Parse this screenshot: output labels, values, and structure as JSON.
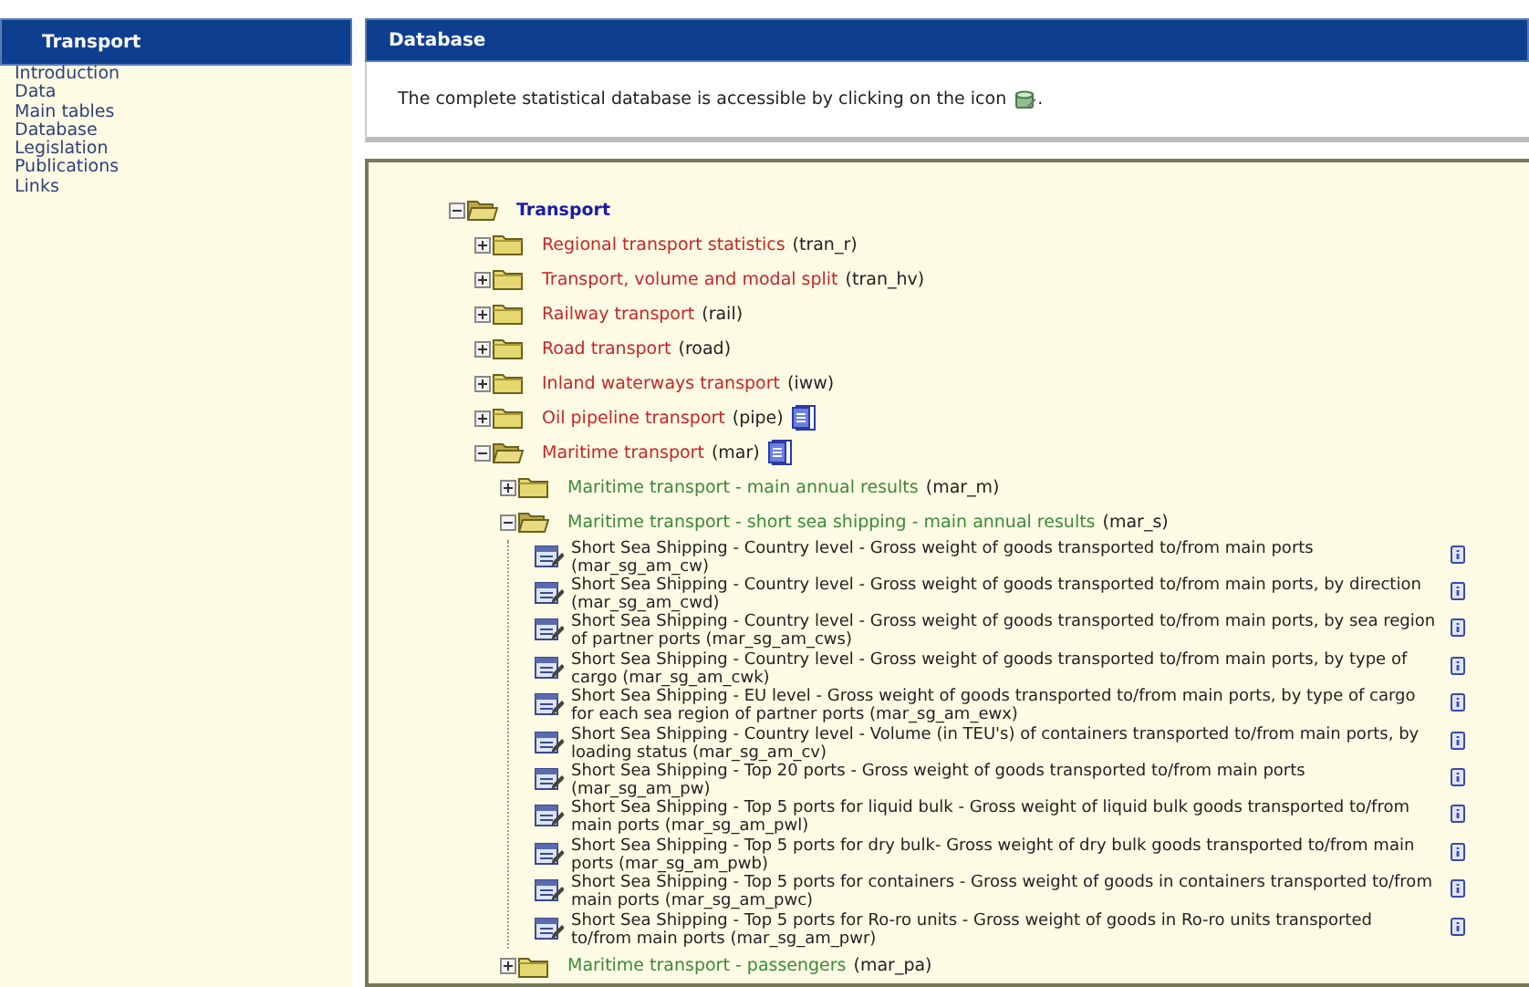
{
  "sidebar": {
    "title": "Transport",
    "items": [
      {
        "label": "Introduction"
      },
      {
        "label": "Data"
      },
      {
        "label": "Main tables"
      },
      {
        "label": "Database"
      },
      {
        "label": "Legislation"
      },
      {
        "label": "Publications"
      },
      {
        "label": "Links"
      }
    ]
  },
  "main": {
    "title": "Database",
    "intro": "The complete statistical database is accessible by clicking on the icon",
    "intro_end": "."
  },
  "tree": {
    "kind": "folder",
    "name": "Transport",
    "expanded": true,
    "doc": false,
    "children": [
      {
        "kind": "folder",
        "name": "Regional transport statistics",
        "code": "(tran_r)",
        "expanded": false,
        "doc": false
      },
      {
        "kind": "folder",
        "name": "Transport, volume and modal split",
        "code": "(tran_hv)",
        "expanded": false,
        "doc": false
      },
      {
        "kind": "folder",
        "name": "Railway transport",
        "code": "(rail)",
        "expanded": false,
        "doc": false
      },
      {
        "kind": "folder",
        "name": "Road transport",
        "code": "(road)",
        "expanded": false,
        "doc": false
      },
      {
        "kind": "folder",
        "name": "Inland waterways transport",
        "code": "(iww)",
        "expanded": false,
        "doc": false
      },
      {
        "kind": "folder",
        "name": "Oil pipeline transport",
        "code": "(pipe)",
        "expanded": false,
        "doc": true
      },
      {
        "kind": "folder",
        "name": "Maritime transport",
        "code": "(mar)",
        "expanded": true,
        "doc": true,
        "children": [
          {
            "kind": "folder",
            "name": "Maritime transport - main annual results",
            "code": "(mar_m)",
            "expanded": false,
            "doc": false
          },
          {
            "kind": "folder",
            "name": "Maritime transport - short sea shipping - main annual results",
            "code": "(mar_s)",
            "expanded": true,
            "doc": false,
            "children": [
              {
                "kind": "table",
                "text": "Short Sea Shipping - Country level - Gross weight of goods transported to/from main ports (mar_sg_am_cw)"
              },
              {
                "kind": "table",
                "text": "Short Sea Shipping - Country level - Gross weight of goods transported to/from main ports, by direction (mar_sg_am_cwd)"
              },
              {
                "kind": "table",
                "text": "Short Sea Shipping - Country level - Gross weight of goods transported to/from main ports, by sea region of partner ports (mar_sg_am_cws)"
              },
              {
                "kind": "table",
                "text": "Short Sea Shipping - Country level - Gross weight of goods transported to/from main ports, by type of cargo (mar_sg_am_cwk)"
              },
              {
                "kind": "table",
                "text": "Short Sea Shipping - EU level - Gross weight of goods transported to/from main ports, by type of cargo for each sea region of partner ports (mar_sg_am_ewx)"
              },
              {
                "kind": "table",
                "text": "Short Sea Shipping - Country level - Volume (in TEU's) of containers transported to/from main ports, by loading status (mar_sg_am_cv)"
              },
              {
                "kind": "table",
                "text": "Short Sea Shipping - Top 20 ports - Gross weight of goods transported to/from main ports (mar_sg_am_pw)"
              },
              {
                "kind": "table",
                "text": "Short Sea Shipping - Top 5 ports for liquid bulk - Gross weight of liquid bulk goods transported to/from main ports (mar_sg_am_pwl)"
              },
              {
                "kind": "table",
                "text": "Short Sea Shipping - Top 5 ports for dry bulk- Gross weight of dry bulk goods transported to/from main ports (mar_sg_am_pwb)"
              },
              {
                "kind": "table",
                "text": "Short Sea Shipping - Top 5 ports for containers - Gross weight of goods in containers transported to/from main ports (mar_sg_am_pwc)"
              },
              {
                "kind": "table",
                "text": "Short Sea Shipping - Top 5 ports for Ro-ro units - Gross weight of goods in Ro-ro units transported to/from main ports (mar_sg_am_pwr)"
              }
            ]
          },
          {
            "kind": "folder",
            "name": "Maritime transport - passengers",
            "code": "(mar_pa)",
            "expanded": false,
            "doc": false
          }
        ]
      }
    ]
  }
}
